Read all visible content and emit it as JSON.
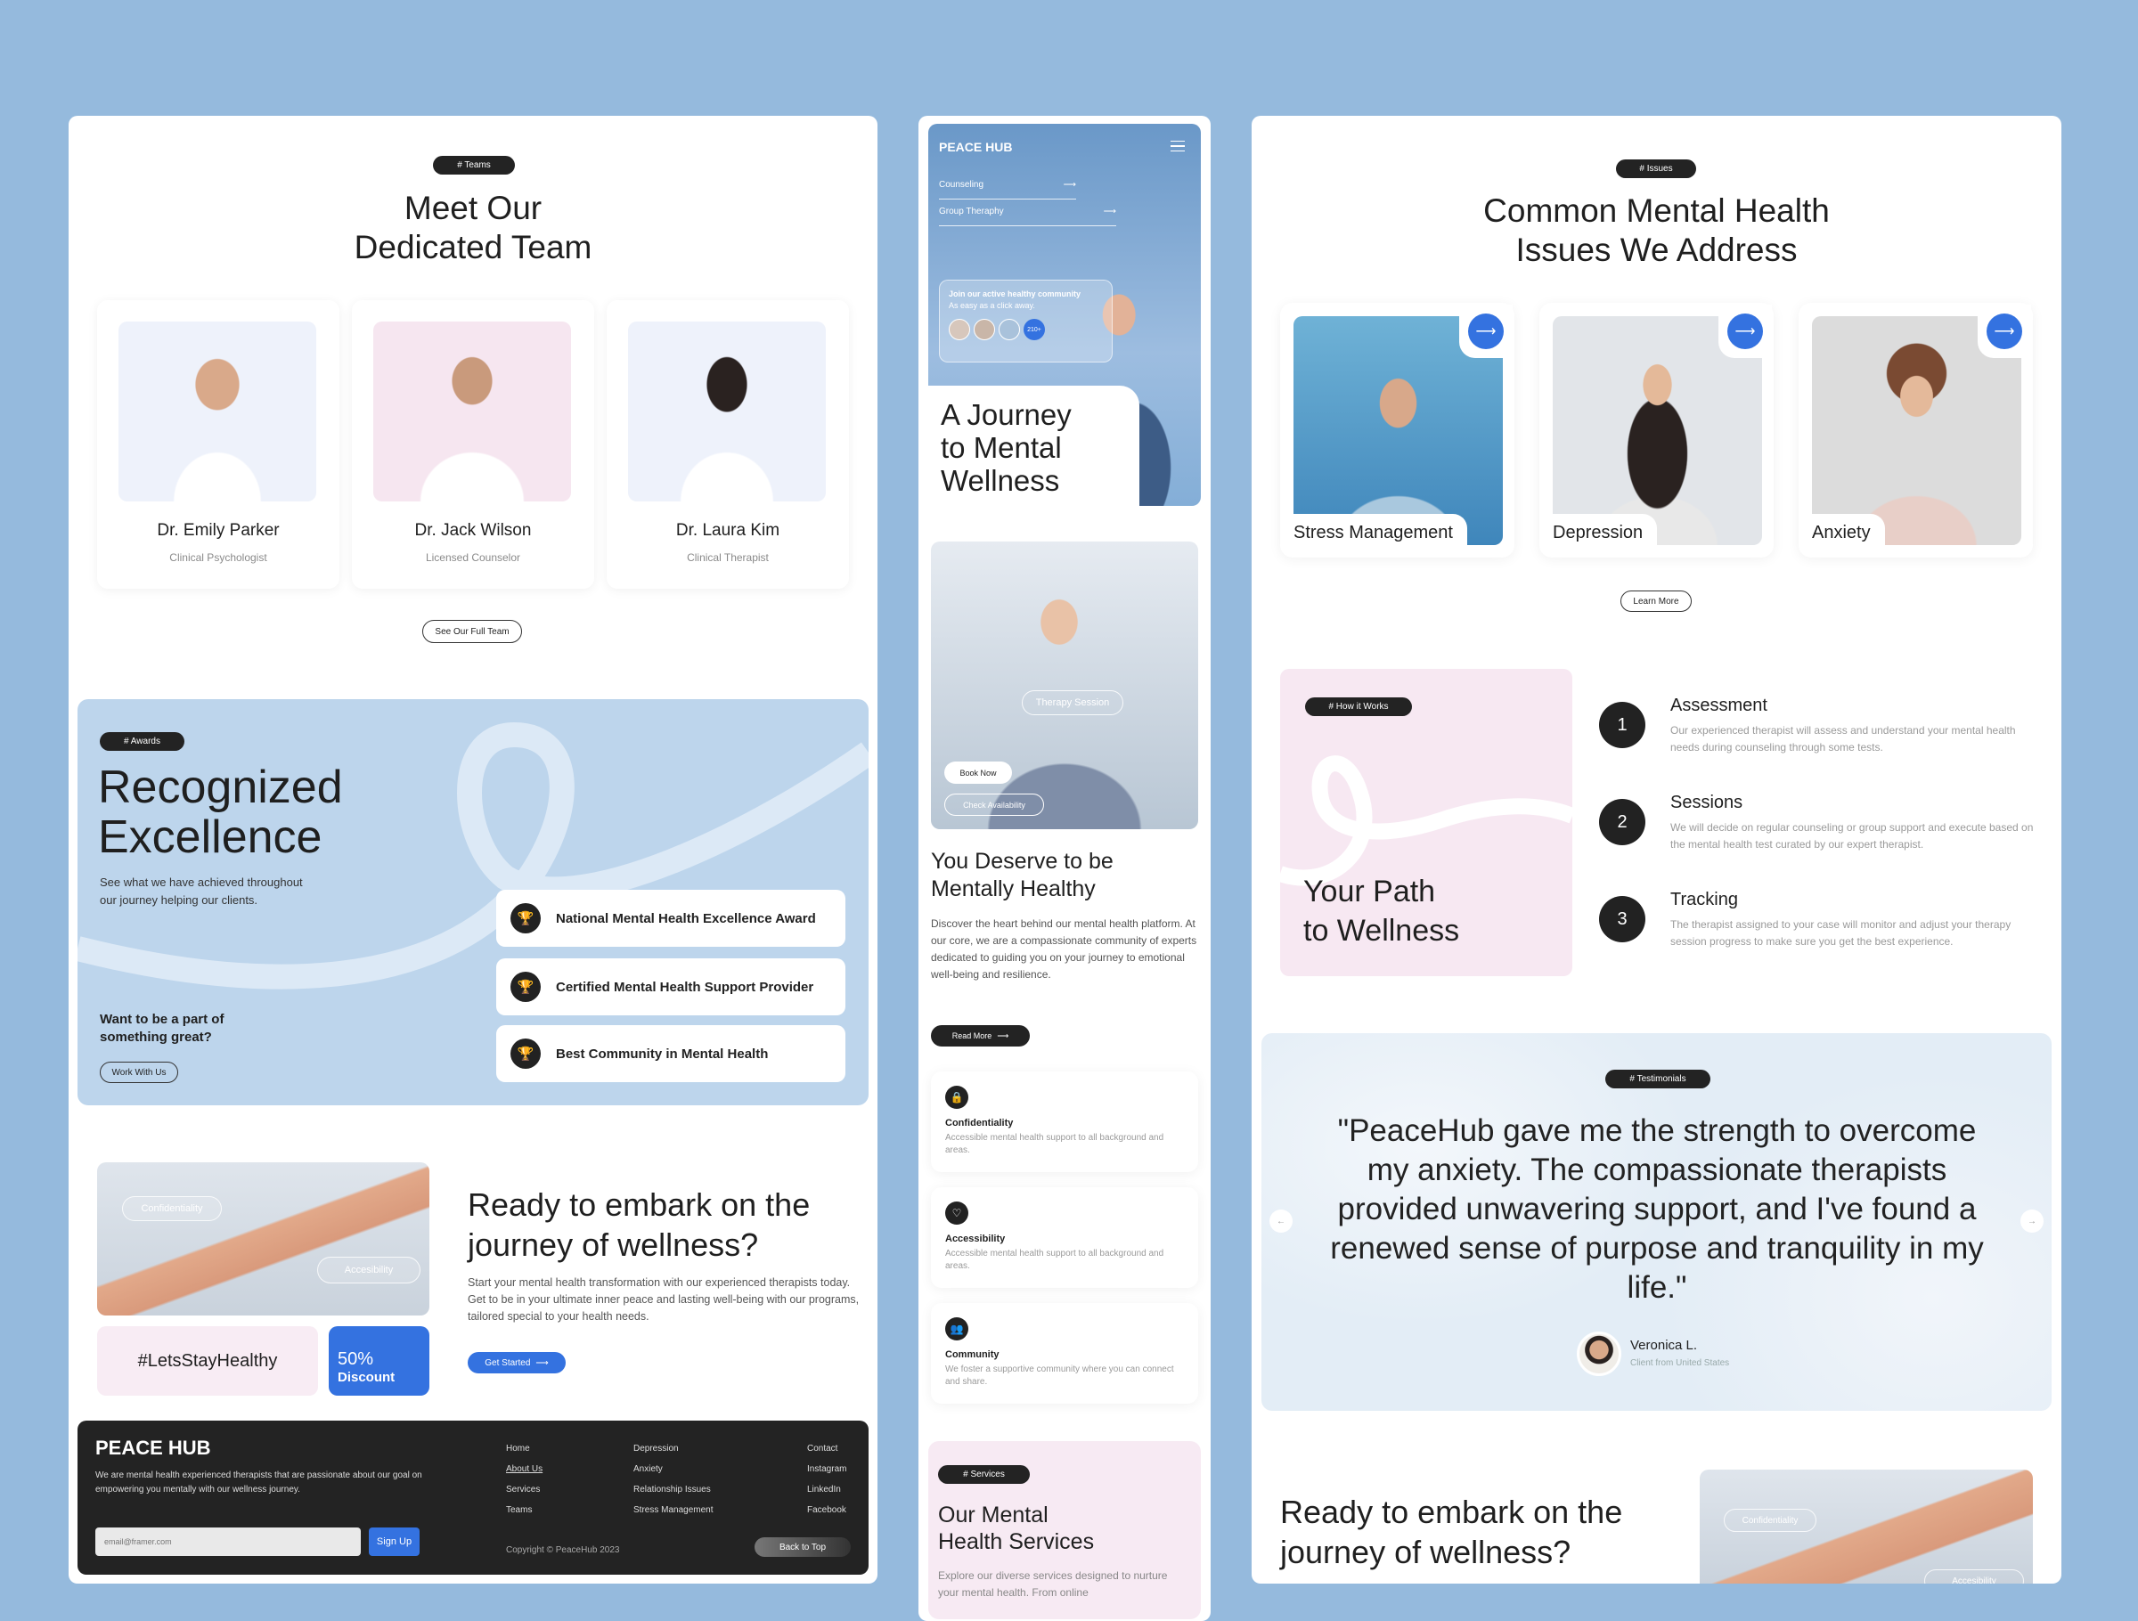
{
  "team": {
    "tag": "# Teams",
    "title_line1": "Meet Our",
    "title_line2": "Dedicated Team",
    "members": [
      {
        "name": "Dr. Emily Parker",
        "role": "Clinical Psychologist"
      },
      {
        "name": "Dr. Jack Wilson",
        "role": "Licensed Counselor"
      },
      {
        "name": "Dr. Laura Kim",
        "role": "Clinical Therapist"
      }
    ],
    "cta": "See Our Full Team"
  },
  "awards": {
    "tag": "# Awards",
    "title_line1": "Recognized",
    "title_line2": "Excellence",
    "subtitle_line1": "See what we have achieved throughout",
    "subtitle_line2": "our journey helping our clients.",
    "items": [
      "National Mental Health Excellence Award",
      "Certified Mental Health Support Provider",
      "Best Community in Mental Health"
    ],
    "join_line1": "Want to be a part of",
    "join_line2": "something great?",
    "join_button": "Work With Us"
  },
  "cta_left": {
    "tag_confidentiality": "Confidentiality",
    "tag_accessibility": "Accesibility",
    "hashtag": "#LetsStayHealthy",
    "discount_value": "50%",
    "discount_label": "Discount",
    "title_line1": "Ready to embark on the",
    "title_line2": "journey of wellness?",
    "body": "Start your mental health transformation with our experienced therapists today. Get to be in your ultimate inner peace and lasting well-being with our programs, tailored special to your health needs.",
    "button": "Get Started"
  },
  "footer": {
    "logo": "PEACE HUB",
    "about": "We are mental health experienced therapists that are passionate about our goal on empowering you mentally with our wellness journey.",
    "email_placeholder": "email@framer.com",
    "signup": "Sign Up",
    "col1": [
      "Home",
      "About Us",
      "Services",
      "Teams"
    ],
    "col2": [
      "Depression",
      "Anxiety",
      "Relationship Issues",
      "Stress Management"
    ],
    "col3": [
      "Contact",
      "Instagram",
      "LinkedIn",
      "Facebook"
    ],
    "copyright": "Copyright © PeaceHub 2023",
    "back_to_top": "Back to Top"
  },
  "mobile": {
    "logo": "PEACE HUB",
    "nav": [
      "Counseling",
      "Group Theraphy"
    ],
    "join_title": "Join our active healthy community",
    "join_sub": "As easy as a click away.",
    "join_count": "210+",
    "hero_line1": "A Journey",
    "hero_line2": "to Mental",
    "hero_line3": "Wellness",
    "session_tag": "Therapy Session",
    "book_now": "Book Now",
    "check_availability": "Check Availability",
    "deserve_line1": "You Deserve to be",
    "deserve_line2": "Mentally Healthy",
    "deserve_body": "Discover the heart behind our mental health platform. At our core, we are a compassionate community of experts dedicated to guiding you on your journey to emotional well-being and resilience.",
    "read_more": "Read More",
    "features": [
      {
        "title": "Confidentiality",
        "desc": "Accessible mental health support to all background and areas.",
        "icon": "lock-icon"
      },
      {
        "title": "Accessibility",
        "desc": "Accessible mental health support to all background and areas.",
        "icon": "heart-pulse-icon"
      },
      {
        "title": "Community",
        "desc": "We foster a supportive community where you can connect and share.",
        "icon": "people-icon"
      }
    ],
    "services_tag": "# Services",
    "services_line1": "Our Mental",
    "services_line2": "Health Services",
    "services_body": "Explore our diverse services designed to nurture your mental health. From online"
  },
  "issues": {
    "tag": "# Issues",
    "title_line1": "Common Mental Health",
    "title_line2": "Issues We Address",
    "items": [
      "Stress Management",
      "Depression",
      "Anxiety"
    ],
    "learn_more": "Learn More"
  },
  "how": {
    "tag": "# How it Works",
    "title_line1": "Your Path",
    "title_line2": "to Wellness",
    "steps": [
      {
        "num": "1",
        "title": "Assessment",
        "desc": "Our experienced therapist will assess and understand your mental health needs during counseling through some tests."
      },
      {
        "num": "2",
        "title": "Sessions",
        "desc": "We will decide on regular counseling or group support and execute based on the mental health test curated by our expert therapist."
      },
      {
        "num": "3",
        "title": "Tracking",
        "desc": "The therapist assigned to your case will monitor and adjust your therapy session progress to make sure you get the best experience."
      }
    ]
  },
  "testimonial": {
    "tag": "# Testimonials",
    "quote": "\"PeaceHub gave me the strength to overcome my anxiety. The compassionate therapists provided unwavering support, and I've found a renewed sense of purpose and tranquility in my life.\"",
    "name": "Veronica L.",
    "location": "Client from United States"
  },
  "cta_right": {
    "title_line1": "Ready to embark on the",
    "title_line2": "journey of wellness?",
    "tag_confidentiality": "Confidentiality",
    "tag_accessibility": "Accesibility"
  },
  "colors": {
    "background": "#95badd",
    "accent_blue": "#3472e0",
    "dark": "#232323",
    "awards_bg": "#bdd5ec",
    "pink": "#f7e9f2"
  }
}
